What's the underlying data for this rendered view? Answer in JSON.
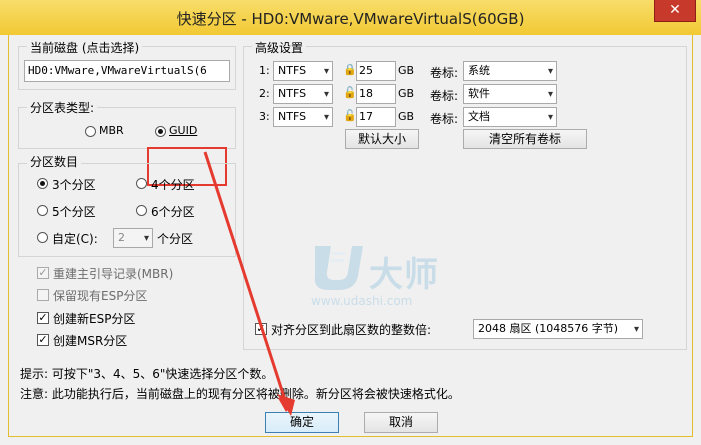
{
  "window": {
    "title": "快速分区 - HD0:VMware,VMwareVirtualS(60GB)",
    "close": "✕"
  },
  "disk": {
    "label": "当前磁盘 (点击选择)",
    "value": "HD0:VMware,VMwareVirtualS(6"
  },
  "partition_table": {
    "label": "分区表类型:",
    "mbr": "MBR",
    "guid": "GUID",
    "selected": "GUID"
  },
  "partition_count": {
    "label": "分区数目",
    "options": [
      "3个分区",
      "4个分区",
      "5个分区",
      "6个分区"
    ],
    "custom_label": "自定(C):",
    "custom_value": "2",
    "custom_suffix": "个分区",
    "selected": "3个分区"
  },
  "checks": {
    "rebuild_mbr": "重建主引导记录(MBR)",
    "keep_esp": "保留现有ESP分区",
    "create_esp": "创建新ESP分区",
    "create_msr": "创建MSR分区"
  },
  "advanced": {
    "label": "高级设置",
    "rows": [
      {
        "num": "1:",
        "fs": "NTFS",
        "size": "25",
        "unit": "GB",
        "vol_label": "卷标:",
        "volume": "系统"
      },
      {
        "num": "2:",
        "fs": "NTFS",
        "size": "18",
        "unit": "GB",
        "vol_label": "卷标:",
        "volume": "软件"
      },
      {
        "num": "3:",
        "fs": "NTFS",
        "size": "17",
        "unit": "GB",
        "vol_label": "卷标:",
        "volume": "文档"
      }
    ],
    "default_size": "默认大小",
    "clear_labels": "清空所有卷标"
  },
  "align": {
    "label": "对齐分区到此扇区数的整数倍:",
    "value": "2048 扇区 (1048576 字节)"
  },
  "watermark": {
    "brand": "大师",
    "url": "www.udashi.com"
  },
  "hints": {
    "tip": "提示: 可按下\"3、4、5、6\"快速选择分区个数。",
    "note": "注意: 此功能执行后，当前磁盘上的现有分区将被删除。新分区将会被快速格式化。"
  },
  "buttons": {
    "ok": "确定",
    "cancel": "取消"
  },
  "colors": {
    "titlebar": "#f2c933",
    "close": "#c7392b",
    "highlight": "#e53a2f"
  }
}
